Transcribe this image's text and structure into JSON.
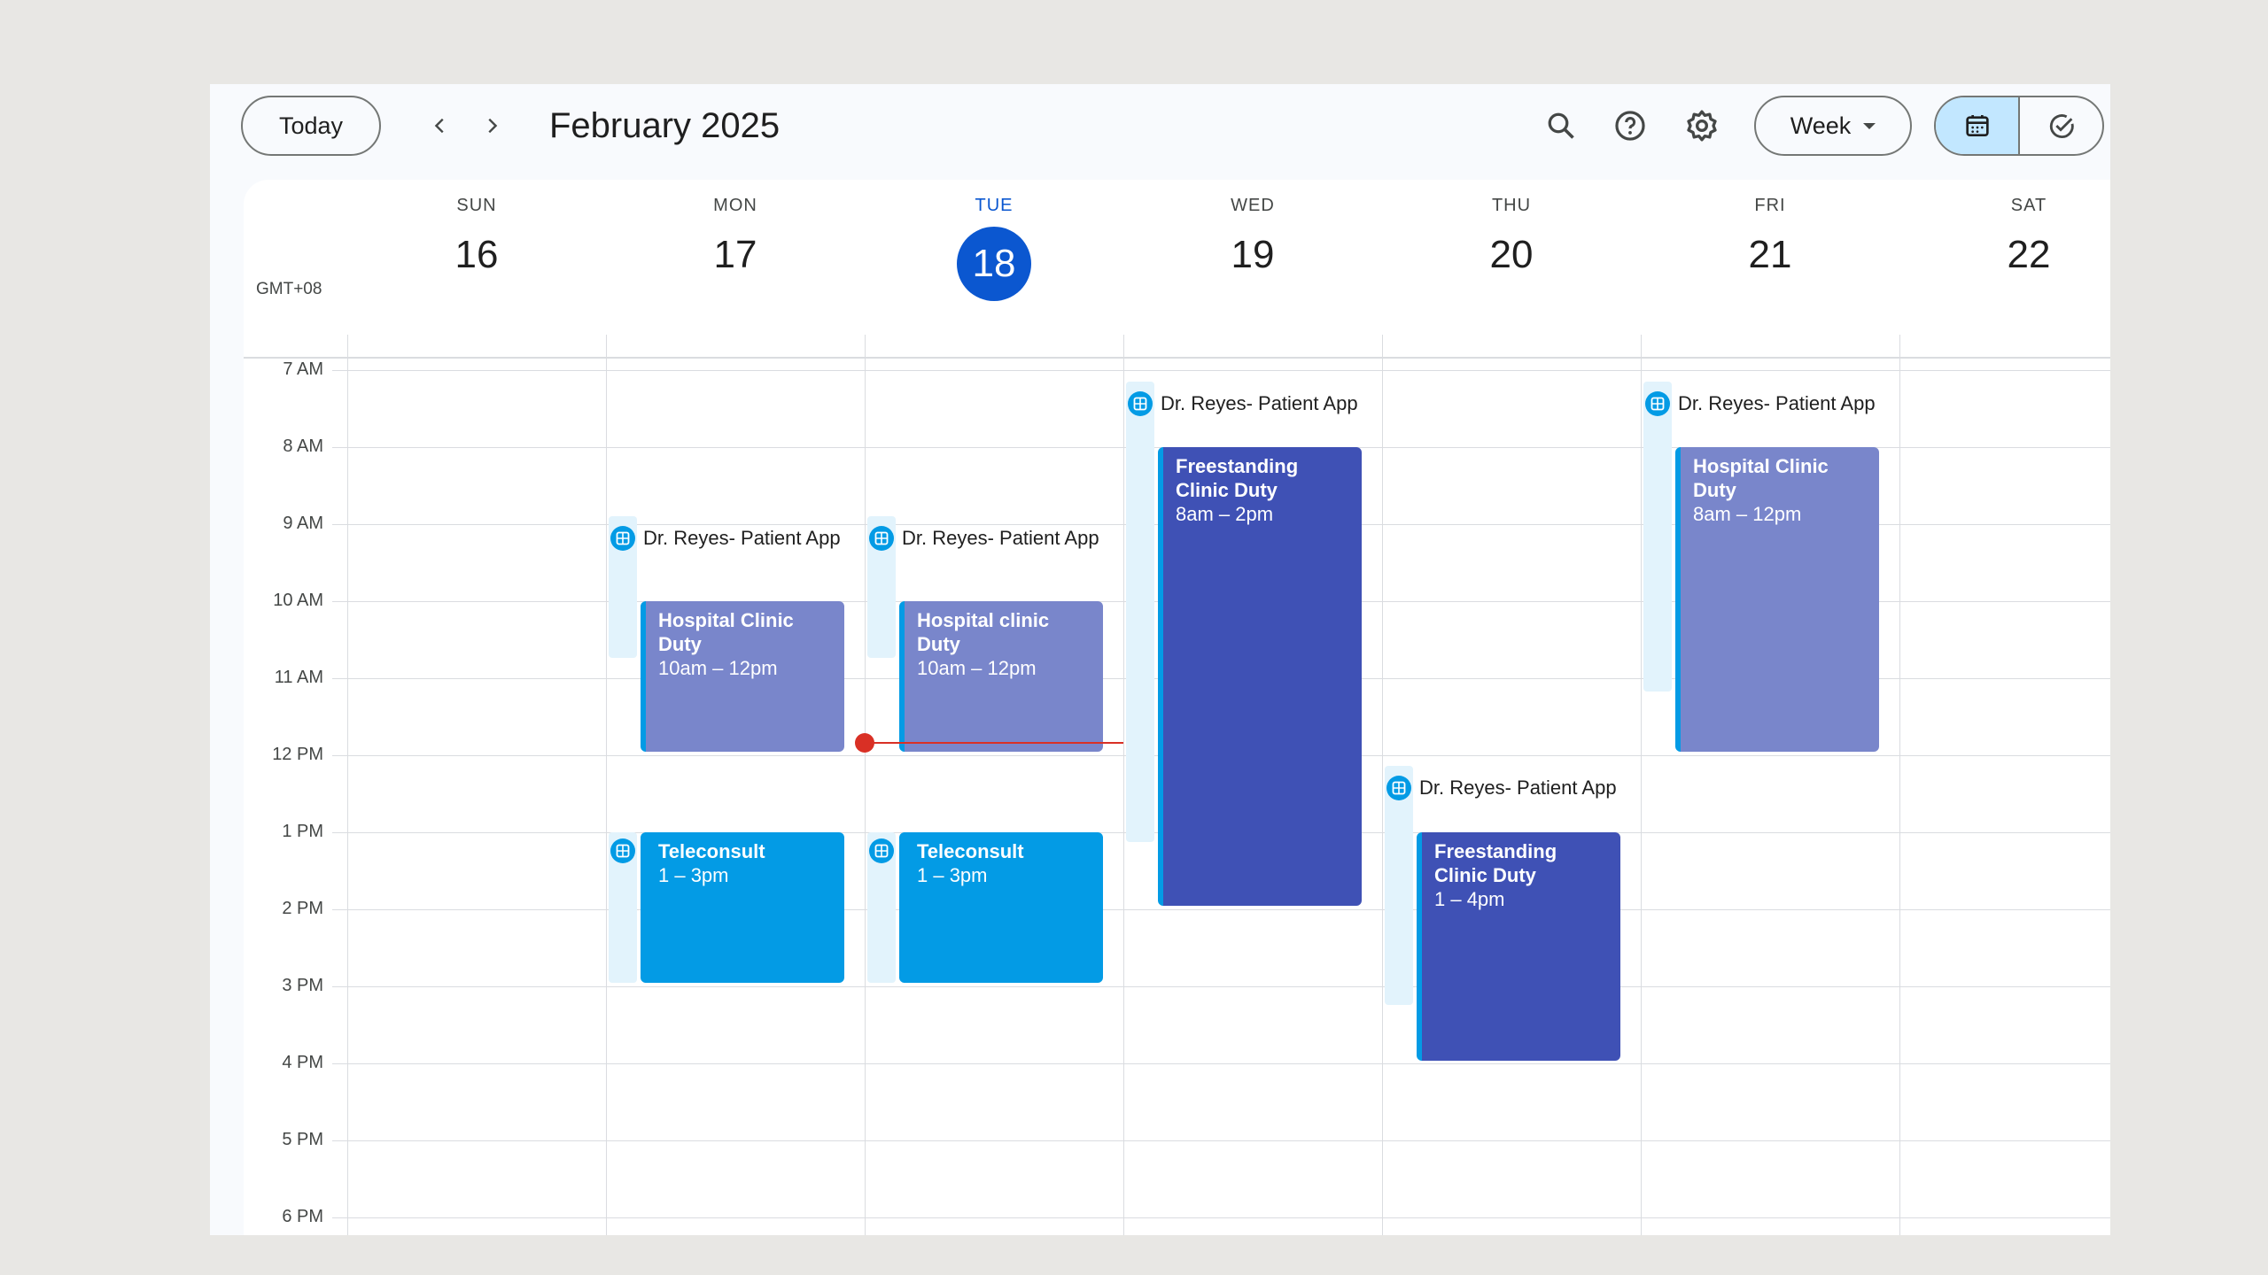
{
  "toolbar": {
    "today_label": "Today",
    "prev_icon": "chevron-left-icon",
    "next_icon": "chevron-right-icon",
    "month_title": "February 2025",
    "view_label": "Week",
    "icons": [
      "search-icon",
      "help-icon",
      "settings-icon",
      "calendar-icon",
      "tasks-check-icon"
    ]
  },
  "timezone": "GMT+08",
  "days": [
    {
      "name": "SUN",
      "num": "16"
    },
    {
      "name": "MON",
      "num": "17"
    },
    {
      "name": "TUE",
      "num": "18",
      "today": true
    },
    {
      "name": "WED",
      "num": "19"
    },
    {
      "name": "THU",
      "num": "20"
    },
    {
      "name": "FRI",
      "num": "21"
    },
    {
      "name": "SAT",
      "num": "22"
    }
  ],
  "hours": [
    "7 AM",
    "8 AM",
    "9 AM",
    "10 AM",
    "11 AM",
    "12 PM",
    "1 PM",
    "2 PM",
    "3 PM",
    "4 PM",
    "5 PM",
    "6 PM"
  ],
  "events": {
    "mon_appt": "Dr. Reyes- Patient Appointments",
    "mon_clinic_title": "Hospital Clinic Duty",
    "mon_clinic_time": "10am – 12pm",
    "mon_tele_title": "Teleconsult",
    "mon_tele_time": "1 – 3pm",
    "tue_appt": "Dr. Reyes- Patient Appointments",
    "tue_clinic_title": "Hospital clinic Duty",
    "tue_clinic_time": "10am – 12pm",
    "tue_tele_title": "Teleconsult",
    "tue_tele_time": "1 – 3pm",
    "wed_appt": "Dr. Reyes- Patient Appointments",
    "wed_clinic_title": "Freestanding Clinic Duty",
    "wed_clinic_time": "8am – 2pm",
    "thu_appt": "Dr. Reyes- Patient Appointments",
    "thu_clinic_title": "Freestanding Clinic Duty",
    "thu_clinic_time": "1 – 4pm",
    "fri_appt": "Dr. Reyes- Patient Appointments",
    "fri_clinic_title": "Hospital Clinic Duty",
    "fri_clinic_time": "8am – 12pm"
  },
  "colors": {
    "accent": "#0b57d0",
    "lavender": "#7986cb",
    "indigo": "#3f51b5",
    "peacock": "#039be5",
    "now_line": "#d93025"
  }
}
